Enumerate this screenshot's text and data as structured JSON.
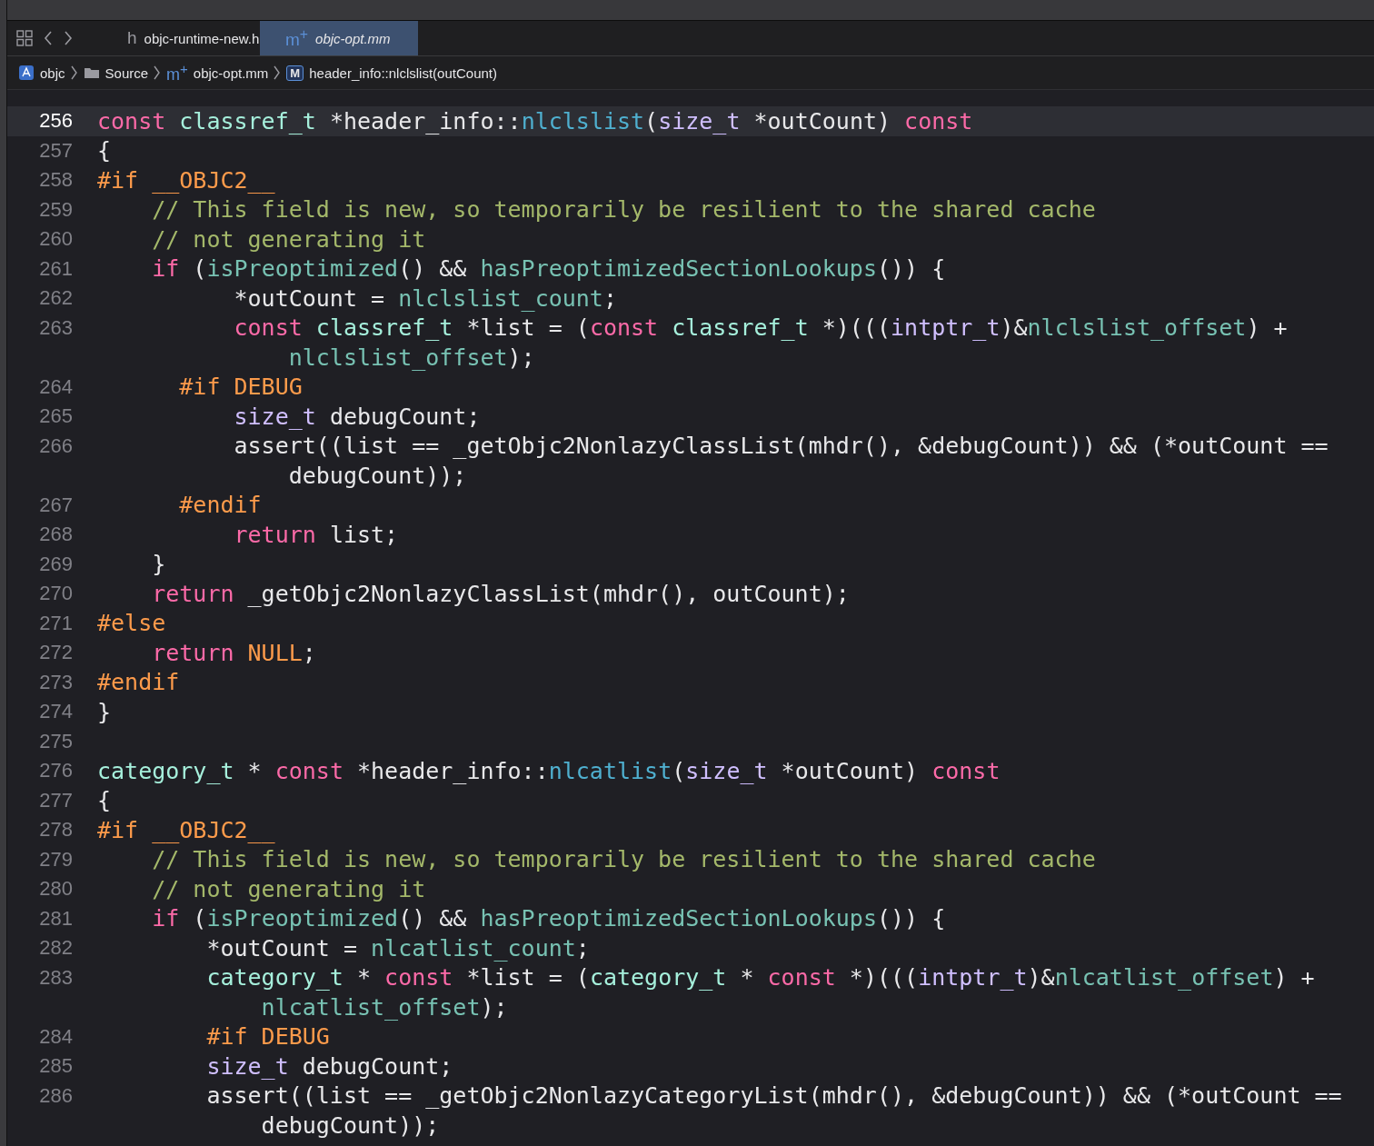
{
  "tabs": [
    {
      "icon": "h",
      "label": "objc-runtime-new.h",
      "selected": false
    },
    {
      "icon": "m$^{+}$",
      "label": "objc-opt.mm",
      "selected": true
    }
  ],
  "breadcrumb": [
    {
      "kind": "project",
      "label": "objc"
    },
    {
      "kind": "folder",
      "label": "Source"
    },
    {
      "kind": "file",
      "icon": "m$^{+}$",
      "label": "objc-opt.mm"
    },
    {
      "kind": "method",
      "icon": "M",
      "label": "header_info::nlclslist(outCount)"
    }
  ],
  "lines": [
    {
      "number": "256",
      "current": true,
      "tokens": [
        {
          "kind": "keyword",
          "text": "const"
        },
        {
          "kind": "type",
          "text": " classref_t"
        },
        {
          "kind": "plain",
          "text": " *header_info::"
        },
        {
          "kind": "decl",
          "text": "nlclslist"
        },
        {
          "kind": "plain",
          "text": "("
        },
        {
          "kind": "system",
          "text": "size_t"
        },
        {
          "kind": "plain",
          "text": " *outCount) "
        },
        {
          "kind": "keyword",
          "text": "const"
        }
      ]
    },
    {
      "number": "257",
      "current": false,
      "tokens": [
        {
          "kind": "plain",
          "text": "{"
        }
      ]
    },
    {
      "number": "258",
      "current": false,
      "tokens": [
        {
          "kind": "preproc",
          "text": "#if __OBJC2__"
        }
      ]
    },
    {
      "number": "259",
      "current": false,
      "tokens": [
        {
          "kind": "comment",
          "text": "    // This field is new, so temporarily be resilient to the shared cache"
        }
      ]
    },
    {
      "number": "260",
      "current": false,
      "tokens": [
        {
          "kind": "comment",
          "text": "    // not generating it"
        }
      ]
    },
    {
      "number": "261",
      "current": false,
      "tokens": [
        {
          "kind": "keyword",
          "text": "    if"
        },
        {
          "kind": "plain",
          "text": " ("
        },
        {
          "kind": "func",
          "text": "isPreoptimized"
        },
        {
          "kind": "plain",
          "text": "() && "
        },
        {
          "kind": "func",
          "text": "hasPreoptimizedSectionLookups"
        },
        {
          "kind": "plain",
          "text": "()) {"
        }
      ]
    },
    {
      "number": "262",
      "current": false,
      "tokens": [
        {
          "kind": "plain",
          "text": "          *outCount = "
        },
        {
          "kind": "func",
          "text": "nlclslist_count"
        },
        {
          "kind": "plain",
          "text": ";"
        }
      ]
    },
    {
      "number": "263",
      "current": false,
      "tokens": [
        {
          "kind": "keyword",
          "text": "          const"
        },
        {
          "kind": "type",
          "text": " classref_t"
        },
        {
          "kind": "plain",
          "text": " *list = ("
        },
        {
          "kind": "keyword",
          "text": "const"
        },
        {
          "kind": "type",
          "text": " classref_t"
        },
        {
          "kind": "plain",
          "text": " *)((("
        },
        {
          "kind": "system",
          "text": "intptr_t"
        },
        {
          "kind": "plain",
          "text": ")&"
        },
        {
          "kind": "func",
          "text": "nlclslist_offset"
        },
        {
          "kind": "plain",
          "text": ") +"
        }
      ],
      "wrap": [
        {
          "kind": "func",
          "text": "              nlclslist_offset"
        },
        {
          "kind": "plain",
          "text": ");"
        }
      ]
    },
    {
      "number": "264",
      "current": false,
      "tokens": [
        {
          "kind": "preproc",
          "text": "      #if DEBUG"
        }
      ]
    },
    {
      "number": "265",
      "current": false,
      "tokens": [
        {
          "kind": "system",
          "text": "          size_t"
        },
        {
          "kind": "plain",
          "text": " debugCount;"
        }
      ]
    },
    {
      "number": "266",
      "current": false,
      "tokens": [
        {
          "kind": "plain",
          "text": "          assert((list == _getObjc2NonlazyClassList(mhdr(), &debugCount)) && (*outCount =="
        }
      ],
      "wrap": [
        {
          "kind": "plain",
          "text": "              debugCount));"
        }
      ]
    },
    {
      "number": "267",
      "current": false,
      "tokens": [
        {
          "kind": "preproc",
          "text": "      #endif"
        }
      ]
    },
    {
      "number": "268",
      "current": false,
      "tokens": [
        {
          "kind": "keyword",
          "text": "          return"
        },
        {
          "kind": "plain",
          "text": " list;"
        }
      ]
    },
    {
      "number": "269",
      "current": false,
      "tokens": [
        {
          "kind": "plain",
          "text": "    }"
        }
      ]
    },
    {
      "number": "270",
      "current": false,
      "tokens": [
        {
          "kind": "keyword",
          "text": "    return"
        },
        {
          "kind": "plain",
          "text": " _getObjc2NonlazyClassList(mhdr(), outCount);"
        }
      ]
    },
    {
      "number": "271",
      "current": false,
      "tokens": [
        {
          "kind": "preproc",
          "text": "#else"
        }
      ]
    },
    {
      "number": "272",
      "current": false,
      "tokens": [
        {
          "kind": "keyword",
          "text": "    return"
        },
        {
          "kind": "preproc",
          "text": " NULL"
        },
        {
          "kind": "plain",
          "text": ";"
        }
      ]
    },
    {
      "number": "273",
      "current": false,
      "tokens": [
        {
          "kind": "preproc",
          "text": "#endif"
        }
      ]
    },
    {
      "number": "274",
      "current": false,
      "tokens": [
        {
          "kind": "plain",
          "text": "}"
        }
      ]
    },
    {
      "number": "275",
      "current": false
    },
    {
      "number": "276",
      "current": false,
      "tokens": [
        {
          "kind": "type",
          "text": "category_t"
        },
        {
          "kind": "plain",
          "text": " * "
        },
        {
          "kind": "keyword",
          "text": "const"
        },
        {
          "kind": "plain",
          "text": " *header_info::"
        },
        {
          "kind": "decl",
          "text": "nlcatlist"
        },
        {
          "kind": "plain",
          "text": "("
        },
        {
          "kind": "system",
          "text": "size_t"
        },
        {
          "kind": "plain",
          "text": " *outCount) "
        },
        {
          "kind": "keyword",
          "text": "const"
        }
      ]
    },
    {
      "number": "277",
      "current": false,
      "tokens": [
        {
          "kind": "plain",
          "text": "{"
        }
      ]
    },
    {
      "number": "278",
      "current": false,
      "tokens": [
        {
          "kind": "preproc",
          "text": "#if __OBJC2__"
        }
      ]
    },
    {
      "number": "279",
      "current": false,
      "tokens": [
        {
          "kind": "comment",
          "text": "    // This field is new, so temporarily be resilient to the shared cache"
        }
      ]
    },
    {
      "number": "280",
      "current": false,
      "tokens": [
        {
          "kind": "comment",
          "text": "    // not generating it"
        }
      ]
    },
    {
      "number": "281",
      "current": false,
      "tokens": [
        {
          "kind": "keyword",
          "text": "    if"
        },
        {
          "kind": "plain",
          "text": " ("
        },
        {
          "kind": "func",
          "text": "isPreoptimized"
        },
        {
          "kind": "plain",
          "text": "() && "
        },
        {
          "kind": "func",
          "text": "hasPreoptimizedSectionLookups"
        },
        {
          "kind": "plain",
          "text": "()) {"
        }
      ]
    },
    {
      "number": "282",
      "current": false,
      "tokens": [
        {
          "kind": "plain",
          "text": "        *outCount = "
        },
        {
          "kind": "func",
          "text": "nlcatlist_count"
        },
        {
          "kind": "plain",
          "text": ";"
        }
      ]
    },
    {
      "number": "283",
      "current": false,
      "tokens": [
        {
          "kind": "type",
          "text": "        category_t"
        },
        {
          "kind": "plain",
          "text": " * "
        },
        {
          "kind": "keyword",
          "text": "const"
        },
        {
          "kind": "plain",
          "text": " *list = ("
        },
        {
          "kind": "type",
          "text": "category_t"
        },
        {
          "kind": "plain",
          "text": " * "
        },
        {
          "kind": "keyword",
          "text": "const"
        },
        {
          "kind": "plain",
          "text": " *)((("
        },
        {
          "kind": "system",
          "text": "intptr_t"
        },
        {
          "kind": "plain",
          "text": ")&"
        },
        {
          "kind": "func",
          "text": "nlcatlist_offset"
        },
        {
          "kind": "plain",
          "text": ") +"
        }
      ],
      "wrap": [
        {
          "kind": "func",
          "text": "            nlcatlist_offset"
        },
        {
          "kind": "plain",
          "text": ");"
        }
      ]
    },
    {
      "number": "284",
      "current": false,
      "tokens": [
        {
          "kind": "preproc",
          "text": "        #if DEBUG"
        }
      ]
    },
    {
      "number": "285",
      "current": false,
      "tokens": [
        {
          "kind": "system",
          "text": "        size_t"
        },
        {
          "kind": "plain",
          "text": " debugCount;"
        }
      ]
    },
    {
      "number": "286",
      "current": false,
      "tokens": [
        {
          "kind": "plain",
          "text": "        assert((list == _getObjc2NonlazyCategoryList(mhdr(), &debugCount)) && (*outCount =="
        }
      ],
      "wrap": [
        {
          "kind": "plain",
          "text": "            debugCount));"
        }
      ]
    }
  ]
}
